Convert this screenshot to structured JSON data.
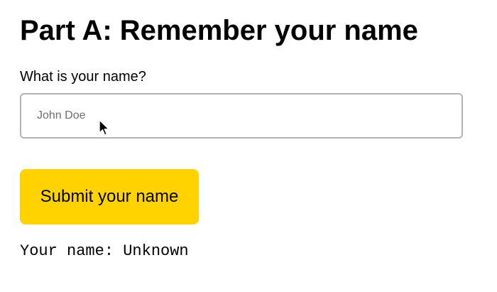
{
  "heading": {
    "title": "Part A: Remember your name"
  },
  "form": {
    "name_label": "What is your name?",
    "name_input": {
      "value": "",
      "placeholder": "John Doe"
    },
    "submit_label": "Submit your name"
  },
  "output": {
    "text": "Your name: Unknown"
  },
  "colors": {
    "button_background": "#ffd200",
    "input_border": "#b4b4b4",
    "placeholder_text": "#6e6e6e"
  },
  "icons": {
    "mouse_cursor": "arrow-cursor-icon"
  }
}
